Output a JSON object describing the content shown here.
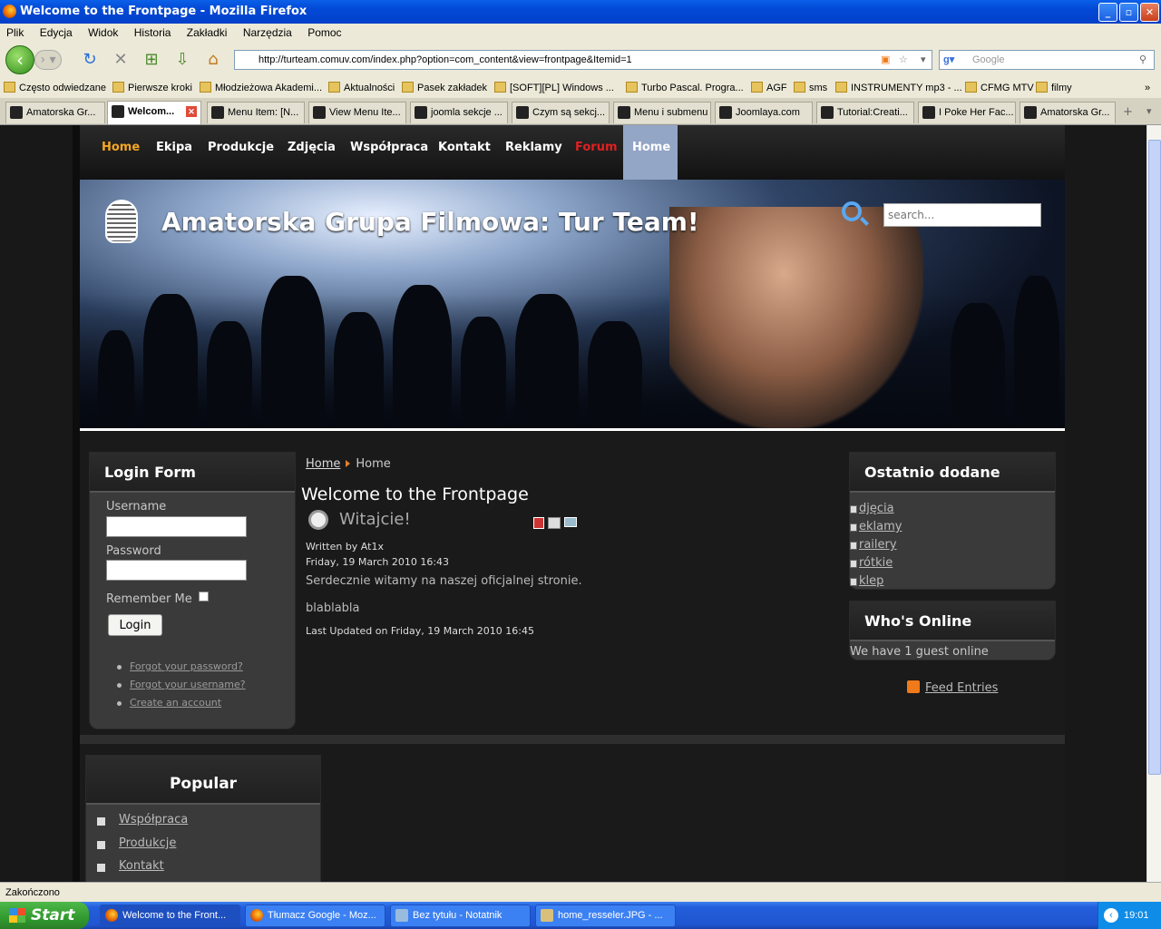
{
  "window": {
    "title": "Welcome to the Frontpage - Mozilla Firefox"
  },
  "menu": [
    "Plik",
    "Edycja",
    "Widok",
    "Historia",
    "Zakładki",
    "Narzędzia",
    "Pomoc"
  ],
  "url": "http://turteam.comuv.com/index.php?option=com_content&view=frontpage&Itemid=1",
  "search_engine_placeholder": "Google",
  "bookmarks": [
    "Często odwiedzane",
    "Pierwsze kroki",
    "Młodzieżowa Akademi...",
    "Aktualności",
    "Pasek zakładek",
    "[SOFT][PL] Windows ...",
    "Turbo Pascal. Progra...",
    "AGF",
    "sms",
    "INSTRUMENTY mp3 - ...",
    "CFMG MTV",
    "filmy"
  ],
  "tabs": [
    "Amatorska Gr...",
    "Welcom...",
    "Menu Item: [N...",
    "View Menu Ite...",
    "joomla sekcje ...",
    "Czym są sekcj...",
    "Menu i submenu",
    "Joomlaya.com",
    "Tutorial:Creati...",
    "I Poke Her Fac...",
    "Amatorska Gr..."
  ],
  "site": {
    "nav": [
      "Home",
      "Ekipa",
      "Produkcje",
      "Zdjęcia",
      "Współpraca",
      "Kontakt",
      "Reklamy",
      "Forum",
      "Home"
    ],
    "title": "Amatorska Grupa Filmowa: Tur Team!",
    "search_placeholder": "search...",
    "login": {
      "heading": "Login Form",
      "username_label": "Username",
      "password_label": "Password",
      "remember_label": "Remember Me",
      "button": "Login",
      "links": [
        "Forgot your password?",
        "Forgot your username?",
        "Create an account"
      ]
    },
    "breadcrumb": {
      "home": "Home",
      "current": "Home"
    },
    "content_title": "Welcome to the Frontpage",
    "article": {
      "title": "Witajcie!",
      "author": "Written by At1x",
      "date": "Friday, 19 March 2010 16:43",
      "p1": "Serdecznie witamy na naszej oficjalnej stronie.",
      "p2": "blablabla",
      "updated": "Last Updated on Friday, 19 March 2010 16:45"
    },
    "latest": {
      "heading": "Ostatnio dodane",
      "items": [
        "djęcia",
        "eklamy",
        "railery",
        "rótkie",
        "klep"
      ]
    },
    "online": {
      "heading": "Who's Online",
      "text": "We have 1 guest online"
    },
    "feed": "Feed Entries",
    "popular": {
      "heading": "Popular",
      "items": [
        "Współpraca",
        "Produkcje",
        "Kontakt"
      ]
    }
  },
  "status": "Zakończono",
  "taskbar": {
    "start": "Start",
    "tasks": [
      "Welcome to the Front...",
      "Tłumacz Google - Moz...",
      "Bez tytułu - Notatnik",
      "home_resseler.JPG - ..."
    ],
    "clock": "19:01"
  }
}
